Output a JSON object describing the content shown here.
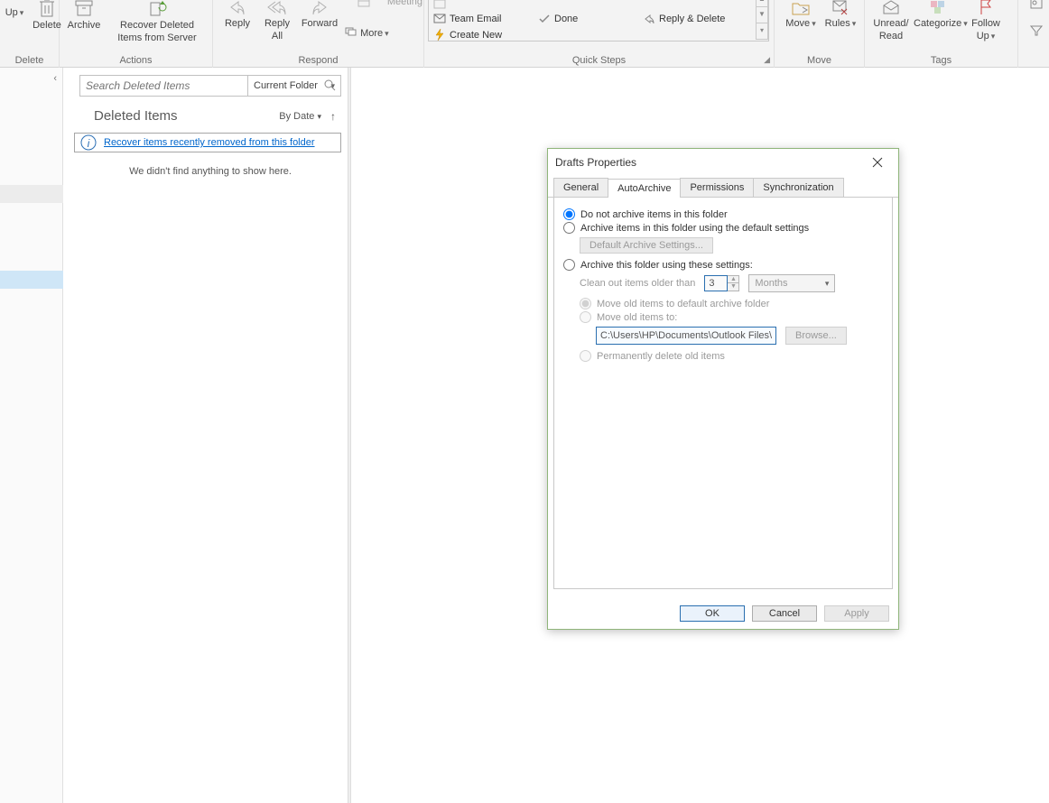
{
  "ribbon": {
    "up_label": "Up",
    "delete_label": "Delete",
    "archive_label": "Archive",
    "recover_label_l1": "Recover Deleted",
    "recover_label_l2": "Items from Server",
    "reply_label": "Reply",
    "replyall_l1": "Reply",
    "replyall_l2": "All",
    "forward_label": "Forward",
    "meeting_label": "Meeting",
    "more_label": "More",
    "qs_team_email": "Team Email",
    "qs_done": "Done",
    "qs_reply_delete": "Reply & Delete",
    "qs_create_new": "Create New",
    "move_label": "Move",
    "rules_label": "Rules",
    "unread_l1": "Unread/",
    "unread_l2": "Read",
    "categorize_label": "Categorize",
    "followup_l1": "Follow",
    "followup_l2": "Up",
    "groups": {
      "delete": "Delete",
      "actions": "Actions",
      "respond": "Respond",
      "quicksteps": "Quick Steps",
      "move": "Move",
      "tags": "Tags"
    }
  },
  "search": {
    "placeholder": "Search Deleted Items",
    "scope": "Current Folder"
  },
  "list": {
    "title": "Deleted Items",
    "sort_by": "By Date",
    "recover_link": "Recover items recently removed from this folder",
    "empty": "We didn't find anything to show here."
  },
  "dialog": {
    "title": "Drafts Properties",
    "tabs": {
      "general": "General",
      "autoarchive": "AutoArchive",
      "permissions": "Permissions",
      "synchronization": "Synchronization"
    },
    "opt_no_archive": "Do not archive items in this folder",
    "opt_default": "Archive items in this folder using the default settings",
    "btn_default_settings": "Default Archive Settings...",
    "opt_custom": "Archive this folder using these settings:",
    "clean_out_label": "Clean out items older than",
    "age_value": "3",
    "age_unit": "Months",
    "move_default": "Move old items to default archive folder",
    "move_to": "Move old items to:",
    "path": "C:\\Users\\HP\\Documents\\Outlook Files\\a",
    "browse": "Browse...",
    "perm_delete": "Permanently delete old items",
    "ok": "OK",
    "cancel": "Cancel",
    "apply": "Apply"
  }
}
